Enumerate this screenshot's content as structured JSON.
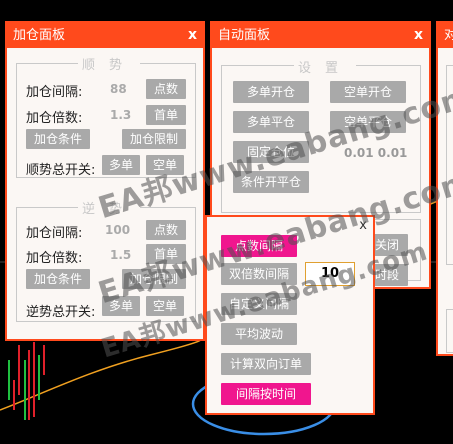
{
  "panel_add": {
    "title": "加仓面板",
    "close": "x",
    "trend_section": "顺势",
    "counter_section": "逆势",
    "trend": {
      "interval_label": "加仓间隔:",
      "interval_value": "88",
      "points_button": "点数",
      "multiplier_label": "加仓倍数:",
      "multiplier_value": "1.3",
      "first_order_button": "首单",
      "condition_button": "加仓条件",
      "limit_button": "加仓限制",
      "master_label": "顺势总开关:",
      "buy_button": "多单",
      "sell_button": "空单"
    },
    "counter": {
      "interval_label": "加仓间隔:",
      "interval_value": "100",
      "points_button": "点数",
      "multiplier_label": "加仓倍数:",
      "multiplier_value": "1.5",
      "first_order_button": "首单",
      "condition_button": "加仓条件",
      "limit_button": "加仓限制",
      "master_label": "逆势总开关:",
      "buy_button": "多单",
      "sell_button": "空单"
    }
  },
  "panel_auto": {
    "title": "自动面板",
    "close": "x",
    "settings_section": "设置",
    "buy_open": "多单开仓",
    "sell_open": "空单开仓",
    "buy_close": "多单平仓",
    "sell_close": "空单平仓",
    "fixed_lot": "固定仓位",
    "lot_values": "0.01  0.01",
    "condition_close": "条件开平仓",
    "close_button": "关闭",
    "period_button": "时段"
  },
  "panel_third": {
    "title": "对"
  },
  "popup": {
    "close": "x",
    "point_interval": "点数间隔",
    "bidirectional_interval": "双倍数间隔",
    "bidirectional_value": "10",
    "custom_interval": "自定义间隔",
    "average_wave": "平均波动",
    "calc_orders": "计算双向订单",
    "time_interval": "间隔按时间"
  },
  "watermarks": [
    "EA邦www.eabang.com",
    "EA邦www.eabang.com",
    "EA邦www.eabang.com"
  ],
  "colors": {
    "panel_border": "#ff4a1c",
    "button_gray": "#a9a9a9",
    "button_pink": "#f0168e",
    "highlight_ellipse": "#3a8ee6",
    "chart_orange": "#f0a020",
    "candle_red": "#e0202a",
    "candle_green": "#20c040"
  }
}
